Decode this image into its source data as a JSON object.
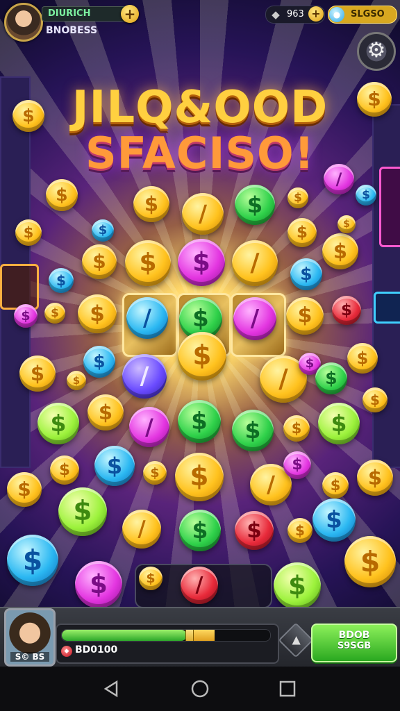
{
  "player": {
    "name": "DIURICH",
    "subtitle": "BNOBESS",
    "add_icon": "plus-icon"
  },
  "resources": [
    {
      "icon": "gem-icon",
      "value": "963",
      "add_icon": "plus-icon"
    },
    {
      "icon": "coin-icon",
      "value": "SLGSO"
    }
  ],
  "settings": {
    "icon": "gear-icon"
  },
  "title": {
    "line1": "JILQ&OOD",
    "line2": "SFACISO!"
  },
  "coin_glyphs": {
    "dollar": "$",
    "bar": "/"
  },
  "bottom_hud": {
    "avatar_label": "S© BS",
    "currency_icon": "ruby-icon",
    "currency_value": "BD0100",
    "progress": 0.6,
    "middle_button_icon": "arrow-up-icon",
    "play_button": {
      "line1": "BDOB",
      "line2": "S9SGB"
    }
  },
  "colors": {
    "gold": "#ffc21e",
    "green": "#2fd14a",
    "pink": "#e335e0",
    "blue": "#2bb8f2",
    "red": "#e82a3a",
    "play_green": "#2aa820"
  },
  "nav": {
    "back_icon": "back-triangle-icon",
    "home_icon": "home-circle-icon",
    "recents_icon": "recents-square-icon"
  }
}
